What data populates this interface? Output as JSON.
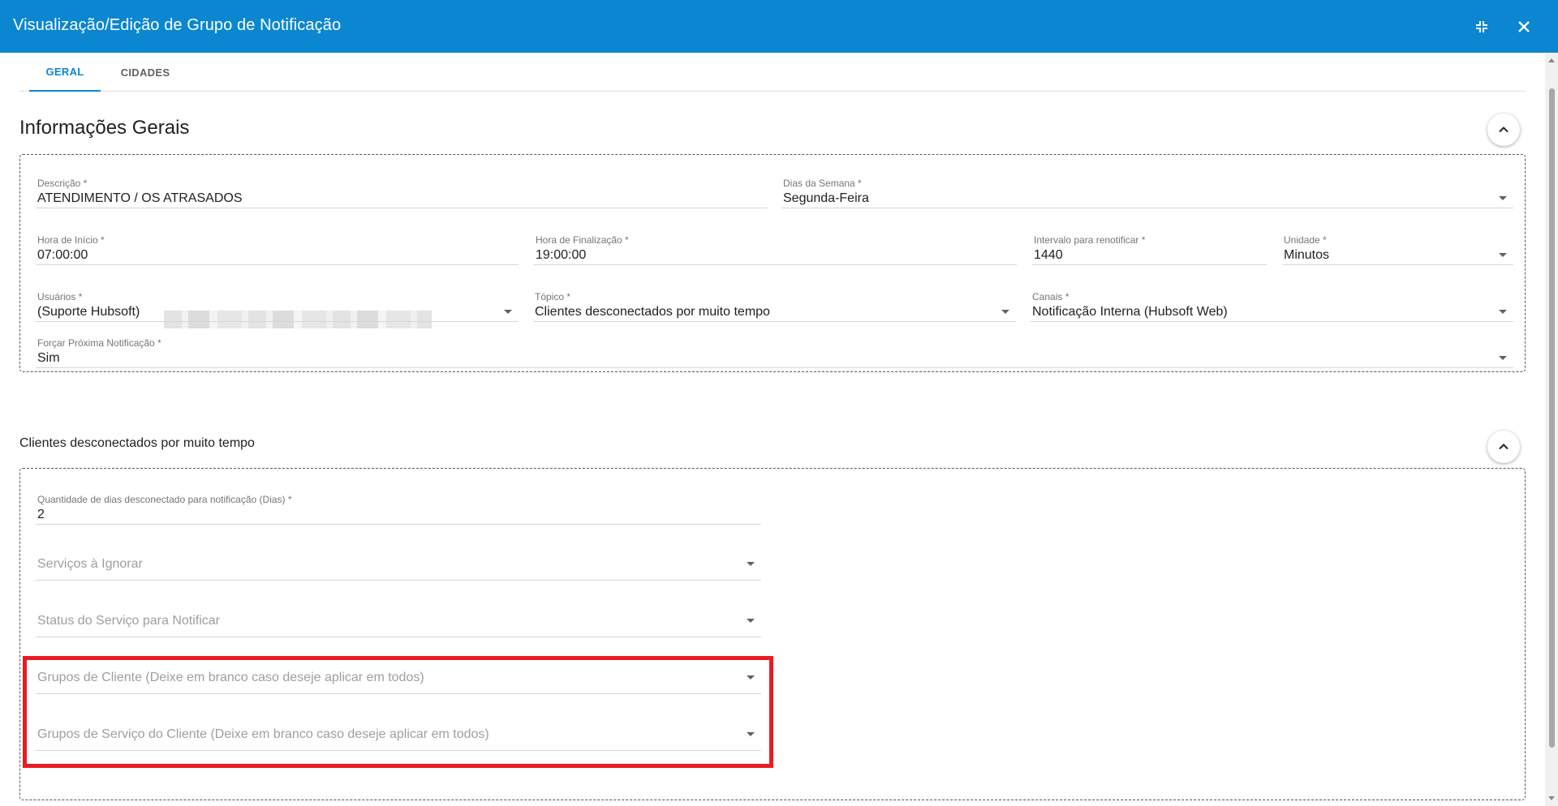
{
  "dialog": {
    "title": "Visualização/Edição de Grupo de Notificação",
    "icons": {
      "minimize": "collapse-icon",
      "close": "close-icon"
    }
  },
  "tabs": [
    {
      "label": "GERAL",
      "active": true
    },
    {
      "label": "CIDADES",
      "active": false
    }
  ],
  "general": {
    "title": "Informações Gerais",
    "fields": {
      "descricao": {
        "label": "Descrição *",
        "value": "ATENDIMENTO / OS ATRASADOS"
      },
      "dias": {
        "label": "Dias da Semana *",
        "value": "Segunda-Feira"
      },
      "hora_inicio": {
        "label": "Hora de Início *",
        "value": "07:00:00"
      },
      "hora_fim": {
        "label": "Hora de Finalização *",
        "value": "19:00:00"
      },
      "intervalo": {
        "label": "Intervalo para renotificar *",
        "value": "1440"
      },
      "unidade": {
        "label": "Unidade *",
        "value": "Minutos"
      },
      "usuarios": {
        "label": "Usuários *",
        "value": "(Suporte Hubsoft)"
      },
      "topico": {
        "label": "Tópico *",
        "value": "Clientes desconectados por muito tempo"
      },
      "canais": {
        "label": "Canais *",
        "value": "Notificação Interna (Hubsoft Web)"
      },
      "forcar": {
        "label": "Forçar Próxima Notificação *",
        "value": "Sim"
      }
    }
  },
  "topic_section": {
    "title": "Clientes desconectados por muito tempo",
    "fields": {
      "quantidade_dias": {
        "label": "Quantidade de dias desconectado para notificação (Dias) *",
        "value": "2"
      },
      "servicos_ignorar": {
        "placeholder": "Serviços à Ignorar"
      },
      "status_servico": {
        "placeholder": "Status do Serviço para Notificar"
      },
      "grupos_cliente": {
        "placeholder": "Grupos de Cliente (Deixe em branco caso deseje aplicar em todos)"
      },
      "grupos_servico_cliente": {
        "placeholder": "Grupos de Serviço do Cliente (Deixe em branco caso deseje aplicar em todos)"
      }
    }
  },
  "colors": {
    "header": "#0a87d0",
    "accent": "#0a87d0",
    "highlight": "#e81c24"
  }
}
